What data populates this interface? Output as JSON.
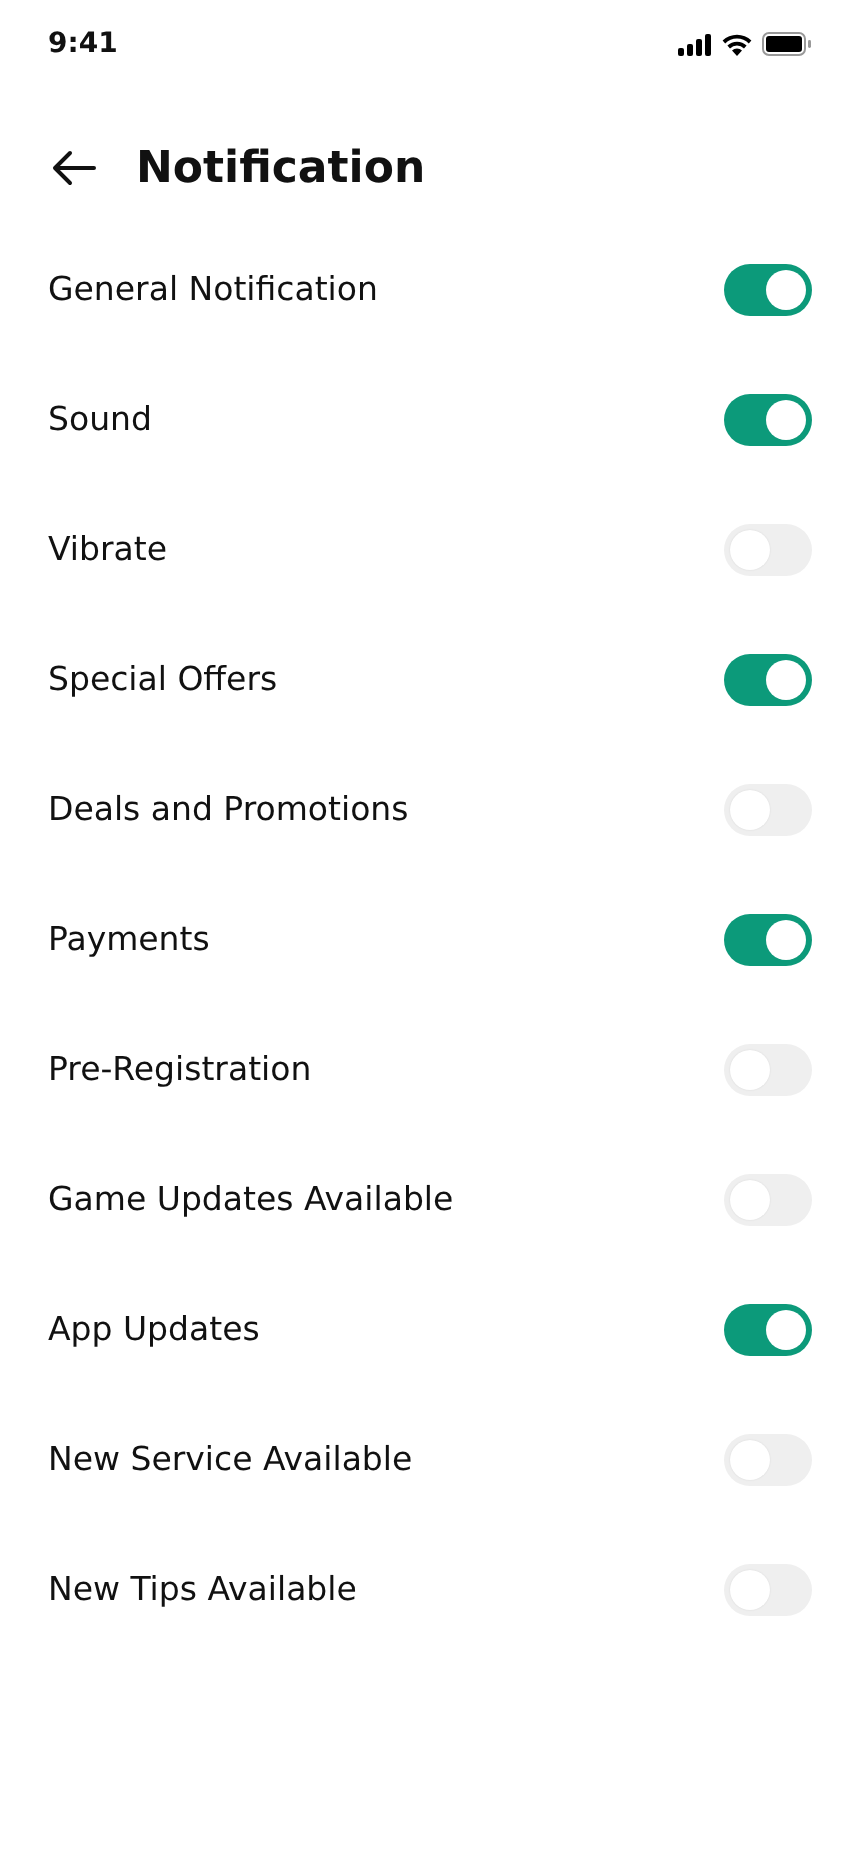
{
  "status_bar": {
    "time": "9:41"
  },
  "header": {
    "title": "Notification"
  },
  "settings": [
    {
      "label": "General Notification",
      "on": true
    },
    {
      "label": "Sound",
      "on": true
    },
    {
      "label": "Vibrate",
      "on": false
    },
    {
      "label": "Special Offers",
      "on": true
    },
    {
      "label": "Deals and Promotions",
      "on": false
    },
    {
      "label": "Payments",
      "on": true
    },
    {
      "label": "Pre-Registration",
      "on": false
    },
    {
      "label": "Game Updates Available",
      "on": false
    },
    {
      "label": "App Updates",
      "on": true
    },
    {
      "label": "New Service Available",
      "on": false
    },
    {
      "label": "New Tips Available",
      "on": false
    }
  ]
}
